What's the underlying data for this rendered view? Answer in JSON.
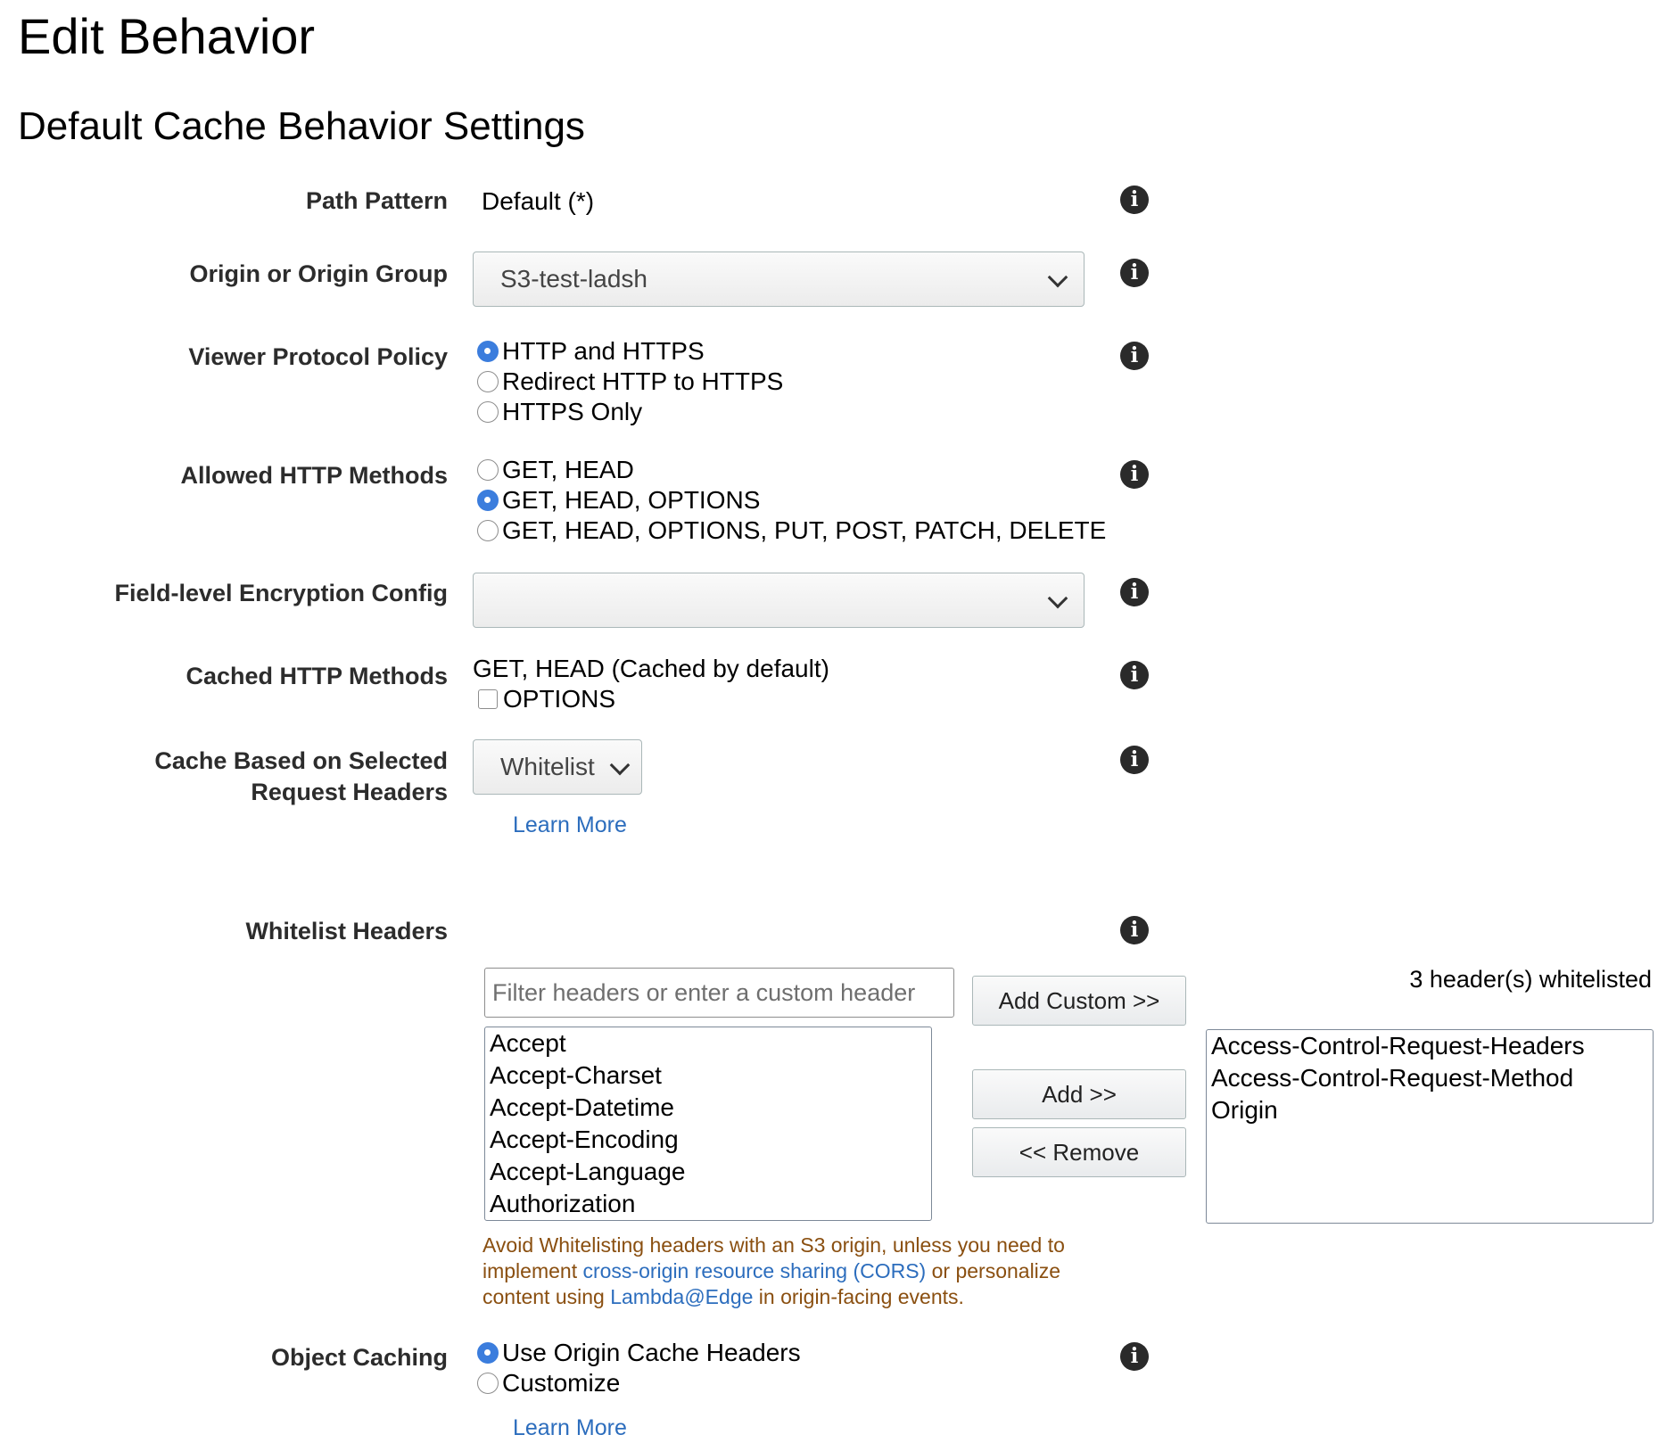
{
  "page": {
    "title": "Edit Behavior",
    "section_title": "Default Cache Behavior Settings"
  },
  "fields": {
    "path_pattern": {
      "label": "Path Pattern",
      "value": "Default (*)"
    },
    "origin": {
      "label": "Origin or Origin Group",
      "selected": "S3-test-ladsh"
    },
    "viewer_protocol": {
      "label": "Viewer Protocol Policy",
      "options": [
        {
          "label": "HTTP and HTTPS",
          "checked": true
        },
        {
          "label": "Redirect HTTP to HTTPS",
          "checked": false
        },
        {
          "label": "HTTPS Only",
          "checked": false
        }
      ]
    },
    "allowed_methods": {
      "label": "Allowed HTTP Methods",
      "options": [
        {
          "label": "GET, HEAD",
          "checked": false
        },
        {
          "label": "GET, HEAD, OPTIONS",
          "checked": true
        },
        {
          "label": "GET, HEAD, OPTIONS, PUT, POST, PATCH, DELETE",
          "checked": false
        }
      ]
    },
    "field_level_encryption": {
      "label": "Field-level Encryption Config",
      "selected": ""
    },
    "cached_methods": {
      "label": "Cached HTTP Methods",
      "default_text": "GET, HEAD (Cached by default)",
      "options_label": "OPTIONS",
      "options_checked": false
    },
    "cache_headers": {
      "label_line1": "Cache Based on Selected",
      "label_line2": "Request Headers",
      "selected": "Whitelist",
      "learn_more": "Learn More"
    },
    "whitelist_headers": {
      "label": "Whitelist Headers",
      "filter_placeholder": "Filter headers or enter a custom header",
      "add_custom": "Add Custom >>",
      "add": "Add >>",
      "remove": "<< Remove",
      "count_text": "3 header(s) whitelisted",
      "available": [
        "Accept",
        "Accept-Charset",
        "Accept-Datetime",
        "Accept-Encoding",
        "Accept-Language",
        "Authorization"
      ],
      "selected": [
        "Access-Control-Request-Headers",
        "Access-Control-Request-Method",
        "Origin"
      ],
      "warning": {
        "part1": "Avoid Whitelisting headers with an S3 origin, unless you need to implement ",
        "link1": "cross-origin resource sharing (CORS)",
        "part2": " or personalize content using ",
        "link2": "Lambda@Edge",
        "part3": " in origin-facing events."
      }
    },
    "object_caching": {
      "label": "Object Caching",
      "options": [
        {
          "label": "Use Origin Cache Headers",
          "checked": true
        },
        {
          "label": "Customize",
          "checked": false
        }
      ],
      "learn_more": "Learn More"
    }
  },
  "icons": {
    "info": "info-icon",
    "dropdown": "chevron-down-icon"
  },
  "colors": {
    "radio_checked": "#3b7ddd",
    "link": "#2c6dbd",
    "warning": "#8a4f10"
  }
}
